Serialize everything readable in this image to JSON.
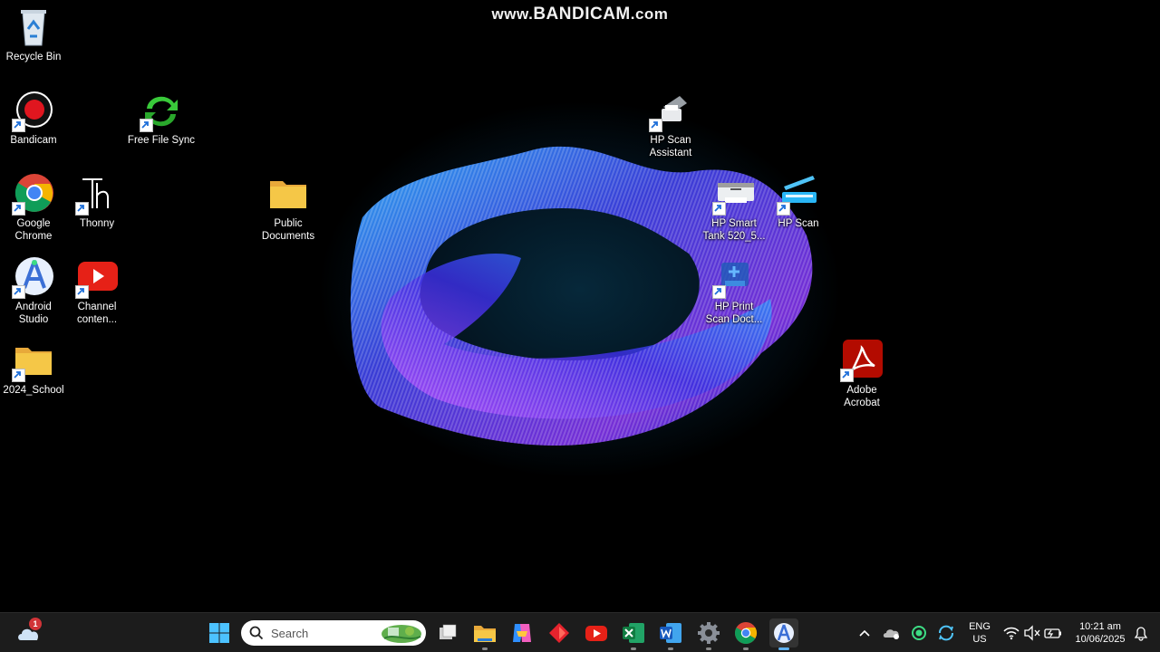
{
  "watermark": {
    "prefix": "www.",
    "brand": "BANDICAM",
    "suffix": ".com"
  },
  "desktop_icons": {
    "recycle_bin": "Recycle Bin",
    "bandicam": "Bandicam",
    "free_file_sync": "Free File Sync",
    "google_chrome": [
      "Google",
      "Chrome"
    ],
    "thonny": "Thonny",
    "public_documents": [
      "Public",
      "Documents"
    ],
    "android_studio": [
      "Android",
      "Studio"
    ],
    "channel_content": [
      "Channel",
      "conten..."
    ],
    "school_folder": "2024_School",
    "hp_scan_assistant": [
      "HP Scan",
      "Assistant"
    ],
    "hp_smart_tank": [
      "HP Smart",
      "Tank 520_5..."
    ],
    "hp_scan": "HP Scan",
    "hp_print_scan": [
      "HP Print",
      "Scan Doct..."
    ],
    "adobe_acrobat": [
      "Adobe",
      "Acrobat"
    ]
  },
  "taskbar": {
    "weather_badge": "1",
    "search_placeholder": "Search",
    "apps": [
      "start-button",
      "search-box",
      "task-view",
      "file-explorer",
      "copilot",
      "app-red",
      "youtube",
      "excel",
      "word",
      "settings",
      "chrome",
      "android-studio"
    ]
  },
  "tray": {
    "lang_top": "ENG",
    "lang_bottom": "US",
    "time": "10:21 am",
    "date": "10/06/2025"
  },
  "colors": {
    "taskbar_bg": "#1c1c1c",
    "accent": "#5fb2f2",
    "folder": "#f5c747",
    "youtube": "#e62117",
    "acrobat": "#b30b00"
  }
}
